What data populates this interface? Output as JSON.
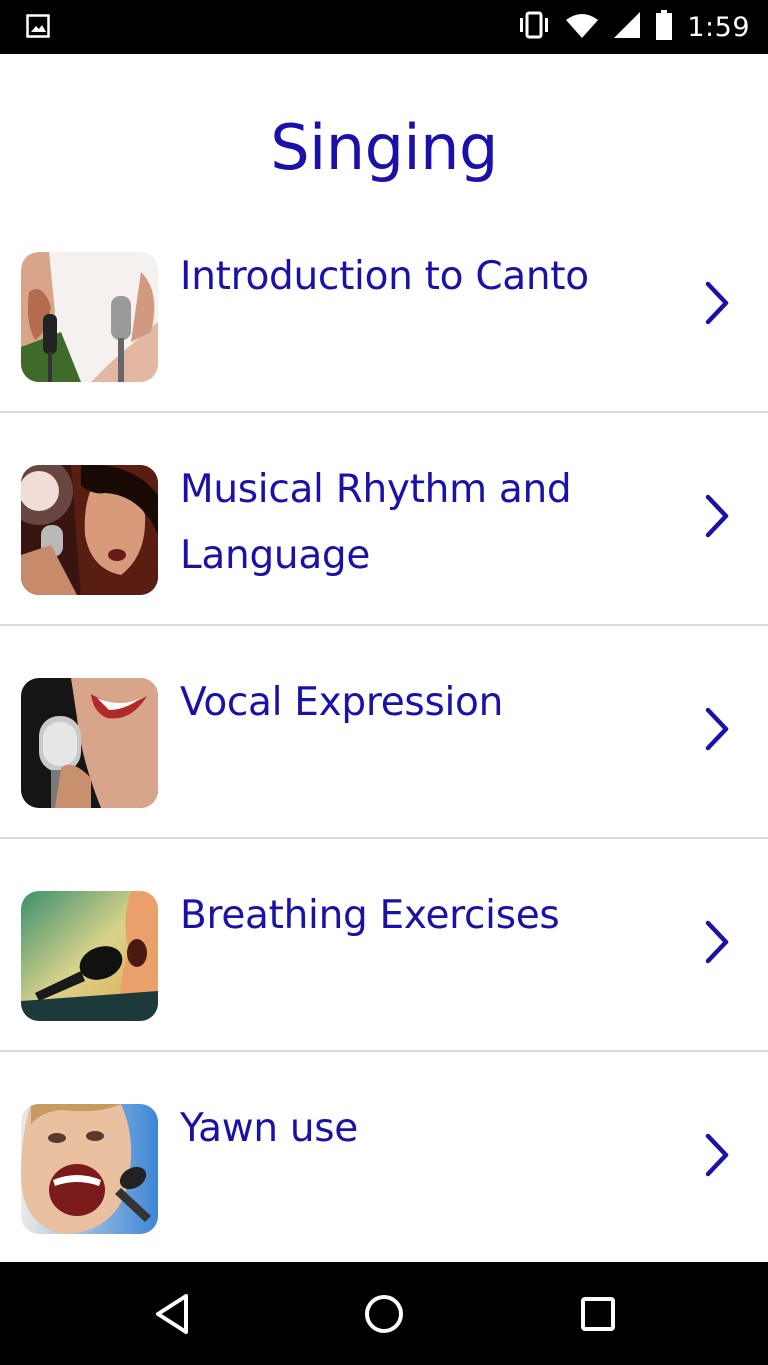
{
  "status_bar": {
    "time": "1:59",
    "icons": [
      "image-notification-icon",
      "vibrate-icon",
      "wifi-icon",
      "cell-signal-icon",
      "battery-icon"
    ]
  },
  "header": {
    "title": "Singing"
  },
  "colors": {
    "accent": "#1a12a8",
    "divider": "#dcdcdc",
    "bars": "#000000"
  },
  "lessons": [
    {
      "label": "Introduction to Canto",
      "icon": "singer-microphone-thumbnail"
    },
    {
      "label": "Musical Rhythm and Language",
      "icon": "singer-microphone-thumbnail"
    },
    {
      "label": "Vocal Expression",
      "icon": "singer-microphone-thumbnail"
    },
    {
      "label": "Breathing Exercises",
      "icon": "singer-microphone-thumbnail"
    },
    {
      "label": "Yawn use",
      "icon": "singer-microphone-thumbnail"
    }
  ],
  "nav_bar": {
    "buttons": [
      "back-icon",
      "home-icon",
      "recents-icon"
    ]
  }
}
